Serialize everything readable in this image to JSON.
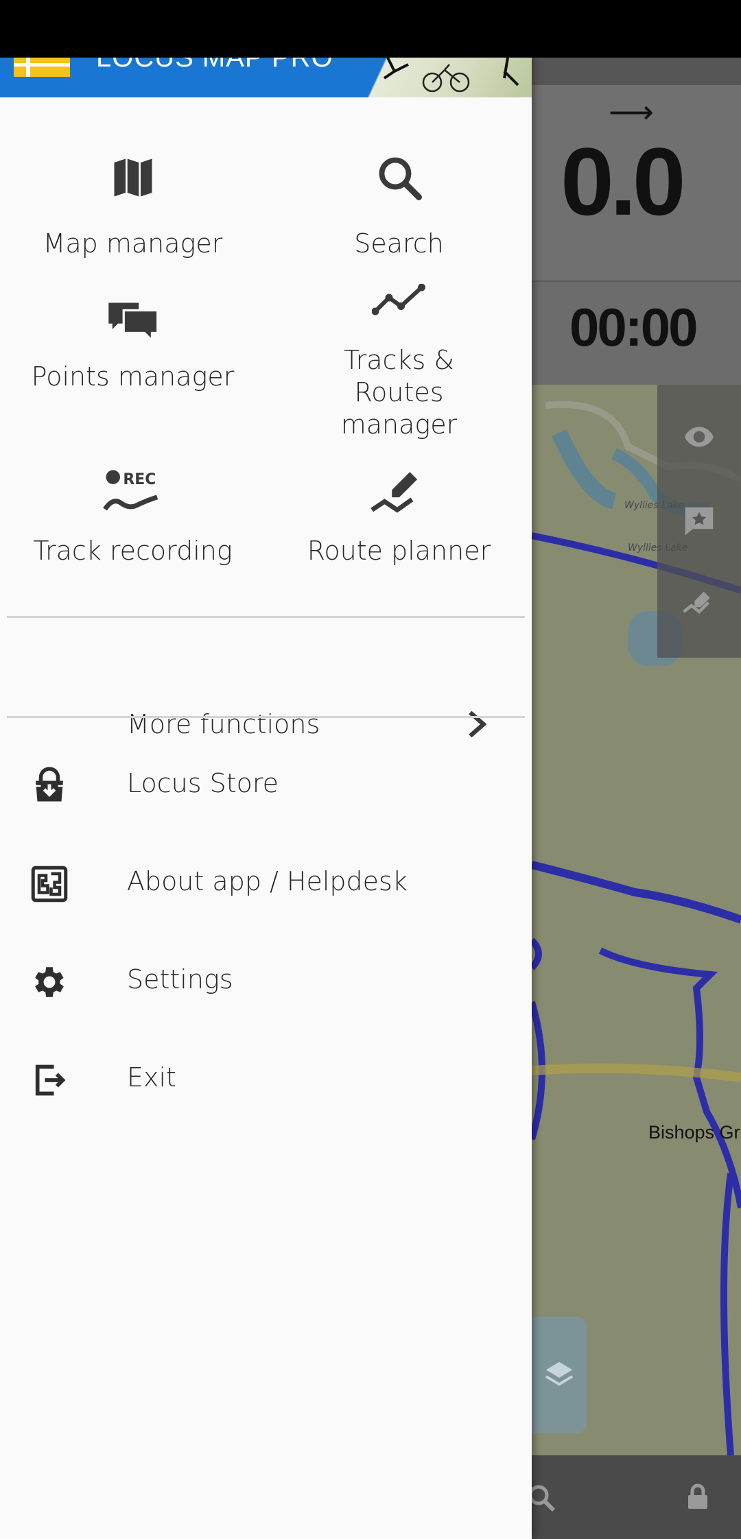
{
  "drawer": {
    "app_title": "LOCUS MAP PRO",
    "grid": [
      {
        "label": "Map manager",
        "icon": "map-icon"
      },
      {
        "label": "Search",
        "icon": "search-icon"
      },
      {
        "label": "Points manager",
        "icon": "points-icon"
      },
      {
        "label": "Tracks & Routes manager",
        "icon": "tracks-icon"
      },
      {
        "label": "Track recording",
        "icon": "track-recording-icon"
      },
      {
        "label": "Route planner",
        "icon": "route-planner-icon"
      }
    ],
    "more_functions": "More functions",
    "list": [
      {
        "label": "Locus Store",
        "icon": "store-icon"
      },
      {
        "label": "About app / Helpdesk",
        "icon": "helpdesk-icon"
      },
      {
        "label": "Settings",
        "icon": "gear-icon"
      },
      {
        "label": "Exit",
        "icon": "exit-icon"
      }
    ],
    "rec_badge": "REC"
  },
  "map": {
    "speed": "0.0",
    "time": "00:00",
    "place_label": "Bishops Gr",
    "lake_label_1": "Wyllies Lake",
    "lake_label_2": "Wyllies Lake"
  },
  "colors": {
    "header_blue": "#1976d2",
    "drawer_bg": "#fafafa",
    "track_blue": "#2d2da8"
  }
}
